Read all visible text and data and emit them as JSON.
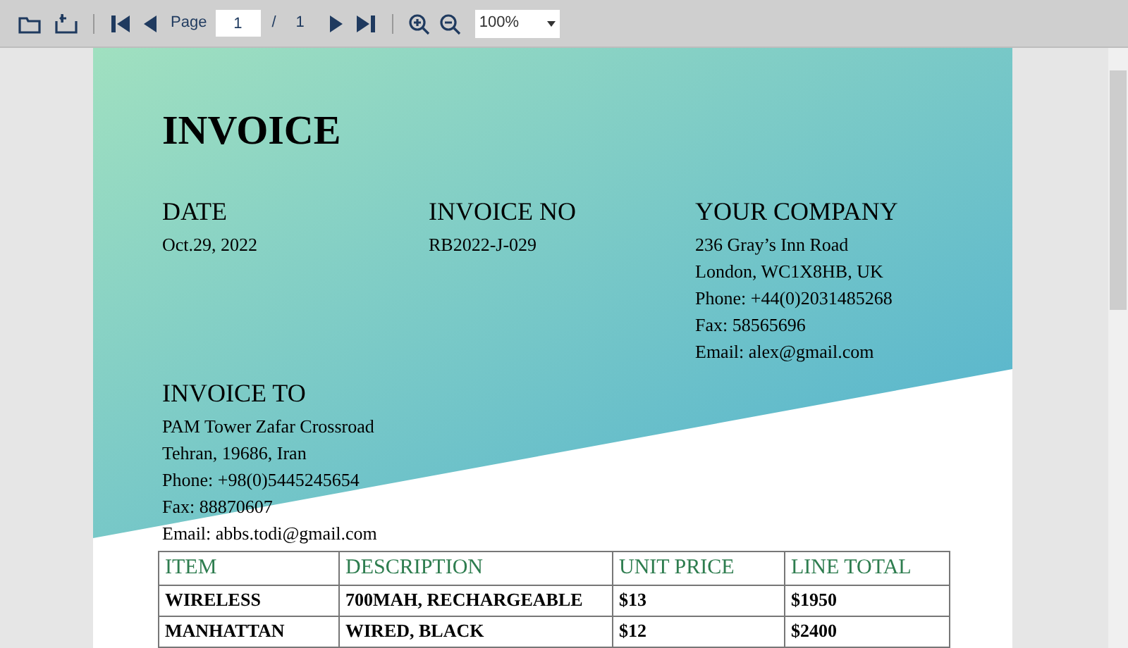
{
  "toolbar": {
    "page_label": "Page",
    "page_value": "1",
    "separator": "/",
    "page_total": "1",
    "zoom": "100%"
  },
  "invoice": {
    "title": "INVOICE",
    "columns": [
      {
        "heading": "DATE",
        "lines": [
          "Oct.29, 2022"
        ]
      },
      {
        "heading": "INVOICE NO",
        "lines": [
          "RB2022-J-029"
        ]
      },
      {
        "heading": "YOUR COMPANY",
        "lines": [
          "236 Gray’s Inn Road",
          "London, WC1X8HB, UK",
          "Phone: +44(0)2031485268",
          "Fax: 58565696",
          "Email: alex@gmail.com"
        ]
      }
    ],
    "bill_to": {
      "heading": "INVOICE TO",
      "lines": [
        "PAM Tower Zafar Crossroad",
        "Tehran, 19686, Iran",
        "Phone: +98(0)5445245654",
        "Fax: 88870607",
        "Email: abbs.todi@gmail.com"
      ]
    },
    "table": {
      "columns": [
        "ITEM",
        "DESCRIPTION",
        "UNIT PRICE",
        "LINE TOTAL"
      ],
      "rows": [
        [
          "WIRELESS",
          "700MAH, RECHARGEABLE",
          "$13",
          "$1950"
        ],
        [
          "MANHATTAN",
          "WIRED, BLACK",
          "$12",
          "$2400"
        ]
      ]
    }
  }
}
